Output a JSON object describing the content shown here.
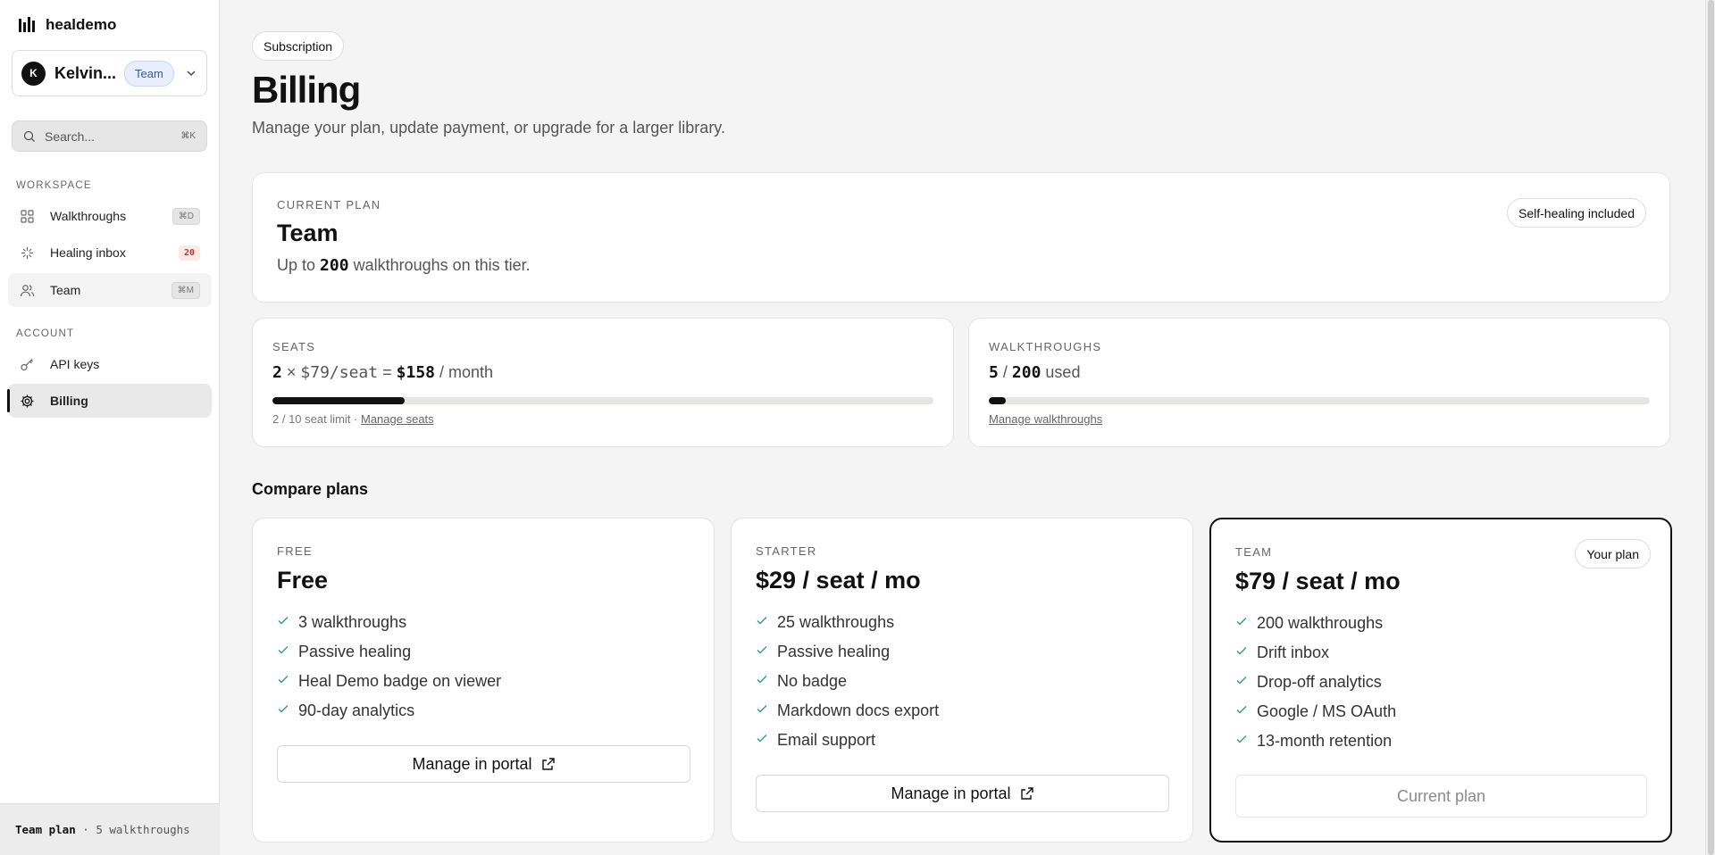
{
  "brand": {
    "name": "healdemo"
  },
  "workspace": {
    "avatar_letter": "K",
    "name": "Kelvin...",
    "badge": "Team"
  },
  "search": {
    "placeholder": "Search...",
    "shortcut": "⌘K"
  },
  "sidebar": {
    "workspace_section": "WORKSPACE",
    "account_section": "ACCOUNT",
    "items": [
      {
        "label": "Walkthroughs",
        "shortcut": "⌘D"
      },
      {
        "label": "Healing inbox",
        "count": "20"
      },
      {
        "label": "Team",
        "shortcut": "⌘M"
      },
      {
        "label": "API keys"
      },
      {
        "label": "Billing"
      }
    ],
    "footer": {
      "plan": "Team plan",
      "detail": "· 5 walkthroughs"
    }
  },
  "header": {
    "chip": "Subscription",
    "title": "Billing",
    "subtitle": "Manage your plan, update payment, or upgrade for a larger library."
  },
  "current_plan": {
    "label": "CURRENT PLAN",
    "name": "Team",
    "desc_prefix": "Up to",
    "desc_number": "200",
    "desc_suffix": "walkthroughs on this tier.",
    "badge": "Self-healing included"
  },
  "seats": {
    "label": "SEATS",
    "count": "2",
    "times": "×",
    "price": "$79/seat",
    "equals": "=",
    "total": "$158",
    "period": "/ month",
    "usage_fraction": 0.2,
    "note": "2 / 10 seat limit ·",
    "link": "Manage seats"
  },
  "walkthroughs": {
    "label": "WALKTHROUGHS",
    "used": "5",
    "slash": "/",
    "limit": "200",
    "suffix": "used",
    "usage_fraction": 0.025,
    "link": "Manage walkthroughs"
  },
  "compare": {
    "title": "Compare plans",
    "tiers": [
      {
        "label": "FREE",
        "price": "Free",
        "features": [
          "3 walkthroughs",
          "Passive healing",
          "Heal Demo badge on viewer",
          "90-day analytics"
        ],
        "button": "Manage in portal"
      },
      {
        "label": "STARTER",
        "price": "$29 / seat / mo",
        "features": [
          "25 walkthroughs",
          "Passive healing",
          "No badge",
          "Markdown docs export",
          "Email support"
        ],
        "button": "Manage in portal"
      },
      {
        "label": "TEAM",
        "price": "$79 / seat / mo",
        "badge": "Your plan",
        "features": [
          "200 walkthroughs",
          "Drift inbox",
          "Drop-off analytics",
          "Google / MS OAuth",
          "13-month retention"
        ],
        "button": "Current plan"
      }
    ]
  },
  "colors": {
    "check": "#2f9e6f",
    "accent": "#111111",
    "badge_bg": "#e8eefb",
    "count_fg": "#c0392b"
  }
}
